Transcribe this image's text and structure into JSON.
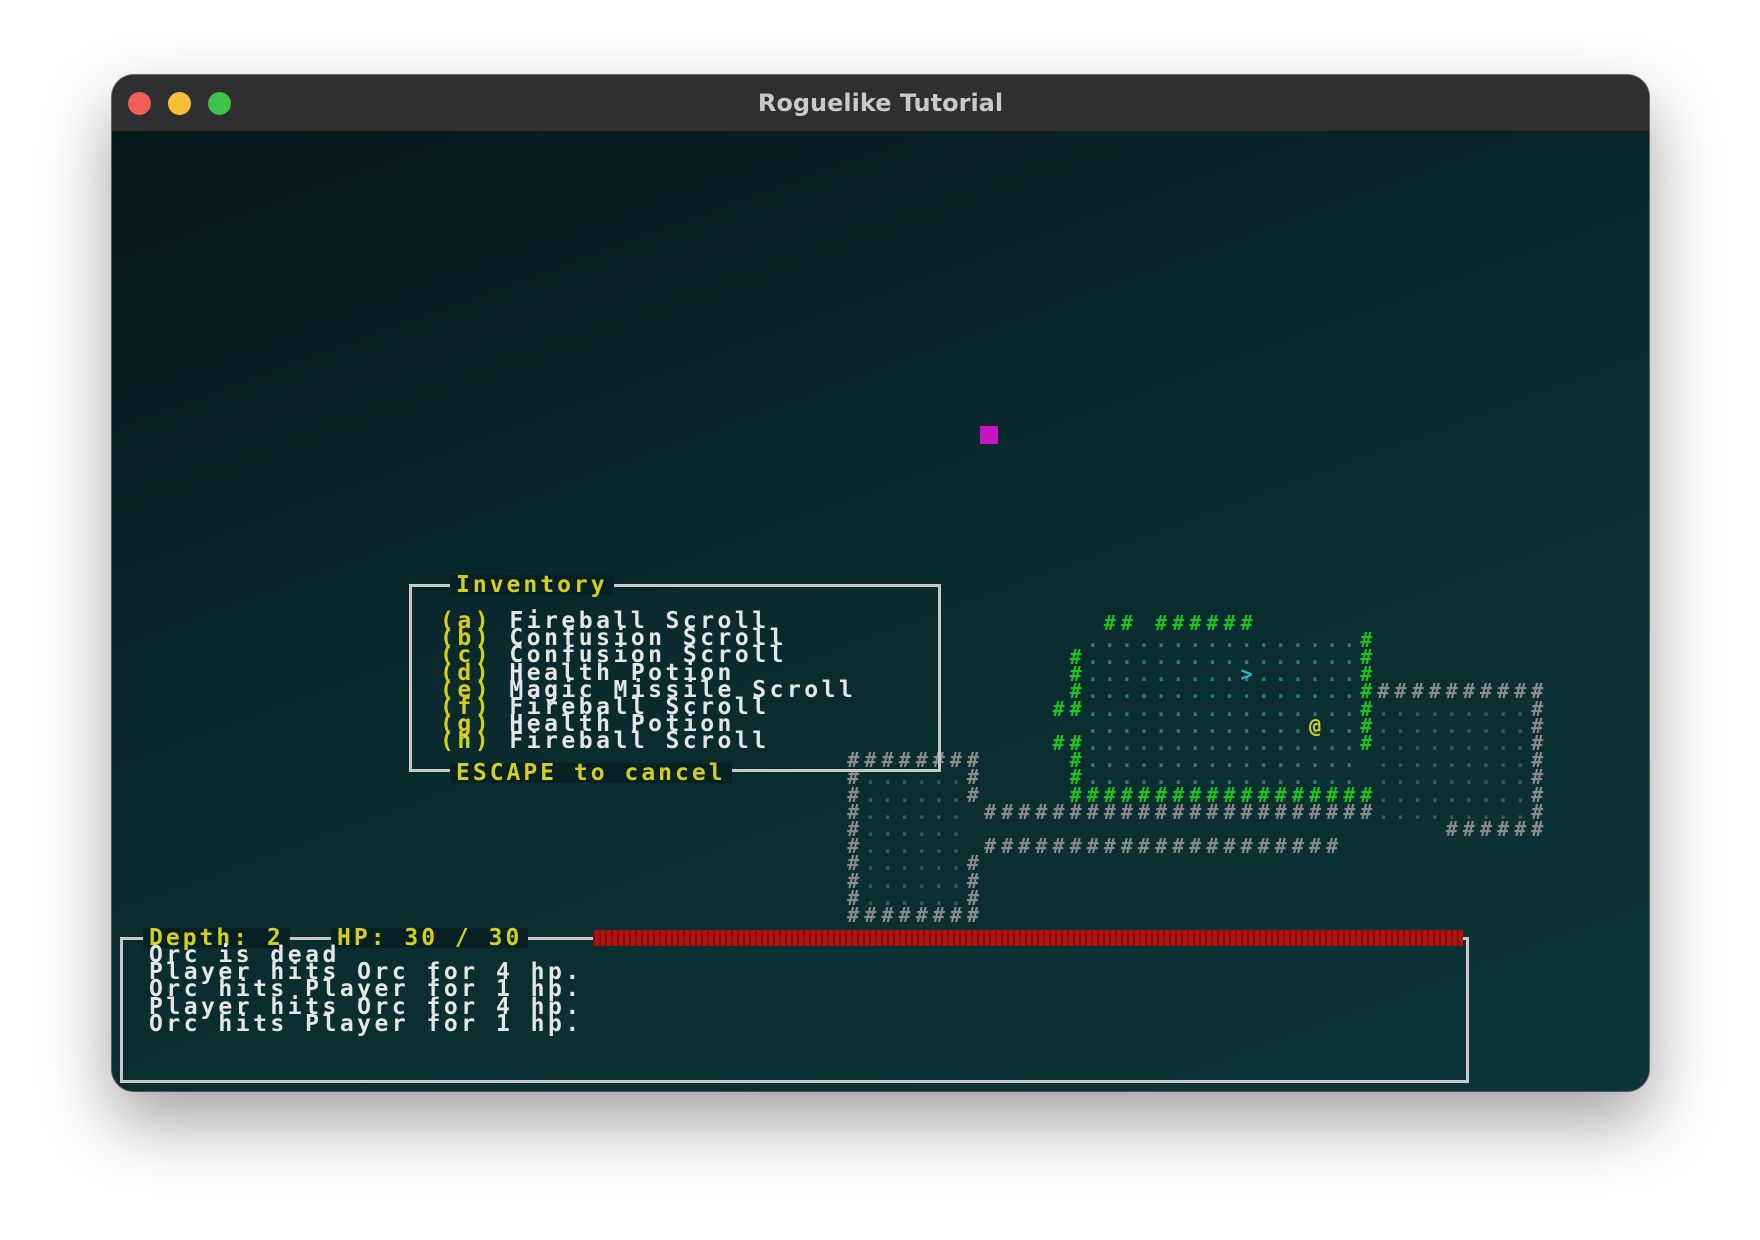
{
  "window": {
    "title": "Roguelike Tutorial"
  },
  "inventory": {
    "title": "Inventory",
    "footer": "ESCAPE to cancel",
    "items": [
      {
        "key": "(a)",
        "name": "Fireball Scroll"
      },
      {
        "key": "(b)",
        "name": "Confusion Scroll"
      },
      {
        "key": "(c)",
        "name": "Confusion Scroll"
      },
      {
        "key": "(d)",
        "name": "Health Potion"
      },
      {
        "key": "(e)",
        "name": "Magic Missile Scroll"
      },
      {
        "key": "(f)",
        "name": "Fireball Scroll"
      },
      {
        "key": "(g)",
        "name": "Health Potion"
      },
      {
        "key": "(h)",
        "name": "Fireball Scroll"
      }
    ]
  },
  "status": {
    "depth_label": "Depth: 2",
    "hp_label": "HP: 30 / 30",
    "hp_current": 30,
    "hp_max": 30
  },
  "log": {
    "lines": [
      "Orc is dead",
      "Player hits Orc for 4 hp.",
      "Orc hits Player for 1 hp.",
      "Player hits Orc for 4 hp.",
      "Orc hits Player for 1 hp."
    ]
  },
  "map": {
    "player_glyph": "@",
    "stairs_glyph": ">",
    "wall_glyph": "#",
    "floor_glyph": ".",
    "colors": {
      "visible_wall": "#1fc21f",
      "remembered_wall": "#8a8a8a",
      "player": "#d4cf1a",
      "stairs": "#29b6c8",
      "magic_item": "#c414c4",
      "hp_bar": "#b01212",
      "ui_text": "#d4cf1a"
    }
  }
}
